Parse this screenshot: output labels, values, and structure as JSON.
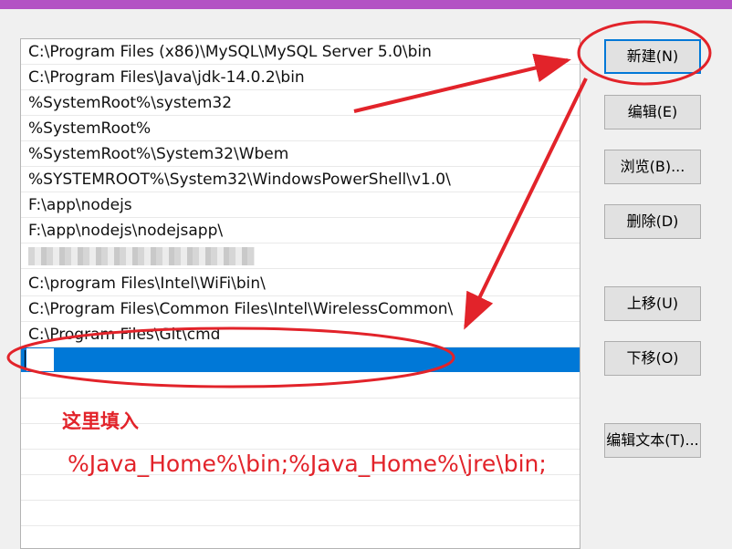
{
  "path_entries": [
    "C:\\Program Files (x86)\\MySQL\\MySQL Server 5.0\\bin",
    "C:\\Program Files\\Java\\jdk-14.0.2\\bin",
    "%SystemRoot%\\system32",
    "%SystemRoot%",
    "%SystemRoot%\\System32\\Wbem",
    "%SYSTEMROOT%\\System32\\WindowsPowerShell\\v1.0\\",
    "F:\\app\\nodejs",
    "F:\\app\\nodejs\\nodejsapp\\",
    "███████████████████",
    "C:\\program Files\\Intel\\WiFi\\bin\\",
    "C:\\Program Files\\Common Files\\Intel\\WirelessCommon\\",
    "C:\\Program Files\\Git\\cmd"
  ],
  "new_entry_value": "",
  "buttons": {
    "new": "新建(N)",
    "edit": "编辑(E)",
    "browse": "浏览(B)...",
    "delete": "删除(D)",
    "move_up": "上移(U)",
    "move_down": "下移(O)",
    "edit_text": "编辑文本(T)..."
  },
  "annotation": {
    "title": "这里填入",
    "path_value": "%Java_Home%\\bin;%Java_Home%\\jre\\bin;",
    "color": "#e2232a"
  },
  "colors": {
    "selection": "#0078d7",
    "title_bar": "#b352c4"
  }
}
